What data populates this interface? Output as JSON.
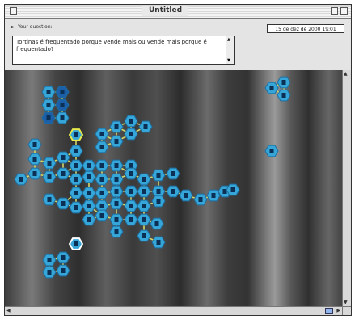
{
  "window": {
    "title": "Untitled"
  },
  "header": {
    "question_label": "Your question:",
    "date": "15 de dez de 2000 19:01",
    "question_text": "Tortinas é frequentado porque vende mais ou vende mais porque é frequentado?"
  },
  "colors": {
    "node_fill": "#36a6d8",
    "node_fill_dark": "#1a5fa8",
    "node_stroke": "#1d6ea0",
    "node_highlight_yellow": "#e8e84a",
    "node_highlight_white": "#ffffff",
    "edge": "#d4d66a"
  },
  "icons": {
    "collapse_arrow": "triangle-right-icon",
    "close_box": "close-box-icon",
    "zoom_box": "zoom-box-icon"
  }
}
